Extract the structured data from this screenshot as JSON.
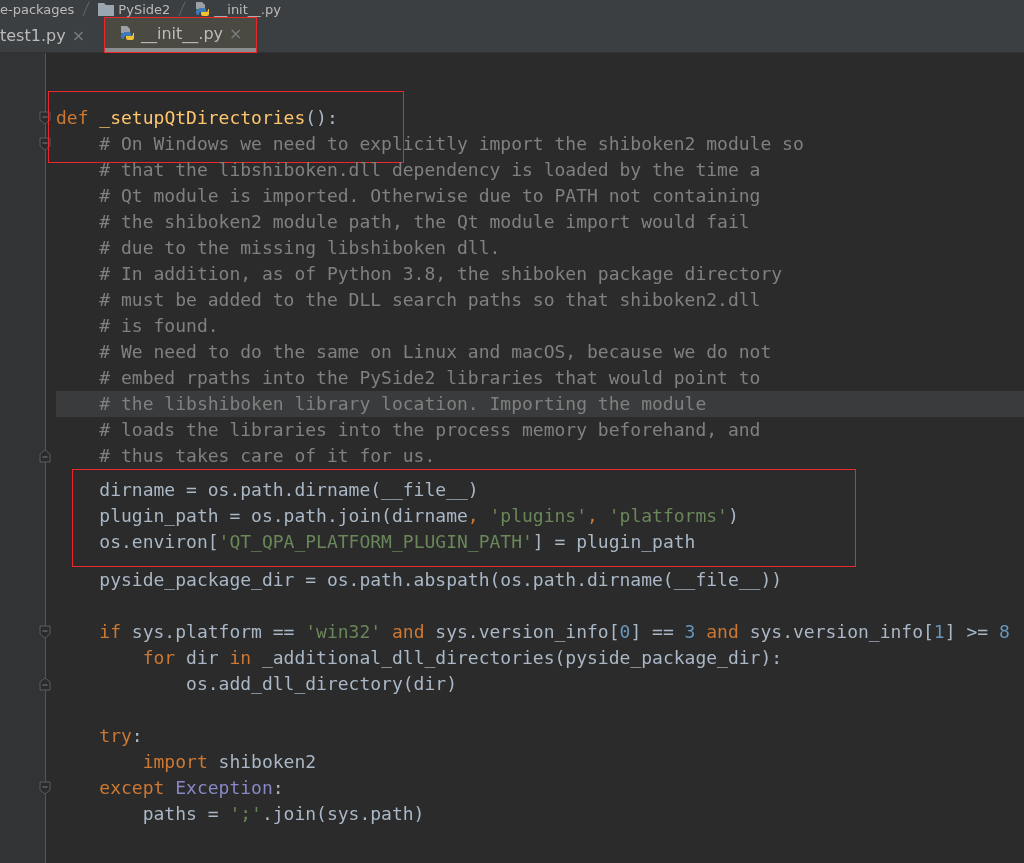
{
  "breadcrumb": [
    {
      "label": "e-packages",
      "kind": "plain"
    },
    {
      "label": "PySide2",
      "kind": "folder"
    },
    {
      "label": "__init__.py",
      "kind": "python"
    }
  ],
  "tabs": [
    {
      "label": "test1.py",
      "close": "×",
      "selected": false,
      "framed": false,
      "kind": "plain"
    },
    {
      "label": "__init__.py",
      "close": "×",
      "selected": true,
      "framed": true,
      "kind": "python"
    }
  ],
  "sections": [
    {
      "framed": false,
      "lines": [
        {
          "kind": "blank"
        },
        {
          "kind": "blank"
        }
      ]
    },
    {
      "framed": true,
      "kind": "partial",
      "lines": [
        {
          "kind": "fold_start",
          "tokens": [
            {
              "kind": "kw",
              "text": "def "
            },
            {
              "kind": "fn",
              "text": "_setupQtDirectories"
            },
            {
              "kind": "plain",
              "text": "():"
            }
          ]
        },
        {
          "kind": "fold_start",
          "tokens": [
            {
              "kind": "cm",
              "text": "    # On Windows we need to explicitly import the shiboken2 module so"
            }
          ]
        }
      ]
    },
    {
      "framed": false,
      "lines": [
        {
          "kind": "code",
          "tokens": [
            {
              "kind": "cm",
              "text": "    # that the libshiboken.dll dependency is loaded by the time a"
            }
          ]
        },
        {
          "kind": "code",
          "tokens": [
            {
              "kind": "cm",
              "text": "    # Qt module is imported. Otherwise due to PATH not containing"
            }
          ]
        },
        {
          "kind": "code",
          "tokens": [
            {
              "kind": "cm",
              "text": "    # the shiboken2 module path, the Qt module import would fail"
            }
          ]
        },
        {
          "kind": "code",
          "tokens": [
            {
              "kind": "cm",
              "text": "    # due to the missing libshiboken dll."
            }
          ]
        },
        {
          "kind": "code",
          "tokens": [
            {
              "kind": "cm",
              "text": "    # In addition, as of Python 3.8, the shiboken package directory"
            }
          ]
        },
        {
          "kind": "code",
          "tokens": [
            {
              "kind": "cm",
              "text": "    # must be added to the DLL search paths so that shiboken2.dll"
            }
          ]
        },
        {
          "kind": "code",
          "tokens": [
            {
              "kind": "cm",
              "text": "    # is found."
            }
          ]
        },
        {
          "kind": "code",
          "tokens": [
            {
              "kind": "cm",
              "text": "    # We need to do the same on Linux and macOS, because we do not"
            }
          ]
        },
        {
          "kind": "code",
          "tokens": [
            {
              "kind": "cm",
              "text": "    # embed rpaths into the PySide2 libraries that would point to"
            }
          ]
        },
        {
          "kind": "code",
          "current": true,
          "tokens": [
            {
              "kind": "cm",
              "text": "    # the libshiboken library location. Importing the module"
            }
          ]
        },
        {
          "kind": "code",
          "tokens": [
            {
              "kind": "cm",
              "text": "    # loads the libraries into the process memory beforehand, and"
            }
          ]
        },
        {
          "kind": "fold_end",
          "tokens": [
            {
              "kind": "cm",
              "text": "    # thus takes care of it for us."
            }
          ]
        }
      ]
    },
    {
      "framed": true,
      "kind": "full",
      "lines": [
        {
          "kind": "code",
          "tokens": [
            {
              "kind": "plain",
              "text": "    dirname = os.path.dirname(__file__)"
            }
          ]
        },
        {
          "kind": "code",
          "tokens": [
            {
              "kind": "plain",
              "text": "    plugin_path = os.path.join(dirname"
            },
            {
              "kind": "kw",
              "text": ", "
            },
            {
              "kind": "str",
              "text": "'plugins'"
            },
            {
              "kind": "kw",
              "text": ", "
            },
            {
              "kind": "str",
              "text": "'platforms'"
            },
            {
              "kind": "plain",
              "text": ")"
            }
          ]
        },
        {
          "kind": "code",
          "tokens": [
            {
              "kind": "plain",
              "text": "    os.environ["
            },
            {
              "kind": "str",
              "text": "'QT_QPA_PLATFORM_PLUGIN_PATH'"
            },
            {
              "kind": "plain",
              "text": "] = plugin_path"
            }
          ]
        }
      ]
    },
    {
      "framed": false,
      "lines": [
        {
          "kind": "code",
          "tokens": [
            {
              "kind": "plain",
              "text": "    pyside_package_dir = os.path.abspath(os.path.dirname(__file__))"
            }
          ]
        },
        {
          "kind": "blank"
        },
        {
          "kind": "fold_start",
          "tokens": [
            {
              "kind": "kw",
              "text": "    if "
            },
            {
              "kind": "plain",
              "text": "sys.platform == "
            },
            {
              "kind": "str",
              "text": "'win32' "
            },
            {
              "kind": "kw",
              "text": "and "
            },
            {
              "kind": "plain",
              "text": "sys.version_info["
            },
            {
              "kind": "num",
              "text": "0"
            },
            {
              "kind": "plain",
              "text": "] == "
            },
            {
              "kind": "num",
              "text": "3 "
            },
            {
              "kind": "kw",
              "text": "and "
            },
            {
              "kind": "plain",
              "text": "sys.version_info["
            },
            {
              "kind": "num",
              "text": "1"
            },
            {
              "kind": "plain",
              "text": "] >= "
            },
            {
              "kind": "num",
              "text": "8"
            }
          ]
        },
        {
          "kind": "code",
          "tokens": [
            {
              "kind": "kw",
              "text": "        for "
            },
            {
              "kind": "plain",
              "text": "dir "
            },
            {
              "kind": "kw",
              "text": "in "
            },
            {
              "kind": "plain",
              "text": "_additional_dll_directories(pyside_package_dir):"
            }
          ]
        },
        {
          "kind": "fold_end",
          "tokens": [
            {
              "kind": "plain",
              "text": "            os.add_dll_directory(dir)"
            }
          ]
        },
        {
          "kind": "blank"
        },
        {
          "kind": "code",
          "tokens": [
            {
              "kind": "kw",
              "text": "    try"
            },
            {
              "kind": "plain",
              "text": ":"
            }
          ]
        },
        {
          "kind": "code",
          "tokens": [
            {
              "kind": "kw",
              "text": "        import "
            },
            {
              "kind": "plain",
              "text": "shiboken2"
            }
          ]
        },
        {
          "kind": "fold_start",
          "tokens": [
            {
              "kind": "kw",
              "text": "    except "
            },
            {
              "kind": "builtin",
              "text": "Exception"
            },
            {
              "kind": "plain",
              "text": ":"
            }
          ]
        },
        {
          "kind": "code",
          "tokens": [
            {
              "kind": "plain",
              "text": "        paths = "
            },
            {
              "kind": "str",
              "text": "';'"
            },
            {
              "kind": "plain",
              "text": ".join(sys.path)"
            }
          ]
        }
      ]
    }
  ]
}
